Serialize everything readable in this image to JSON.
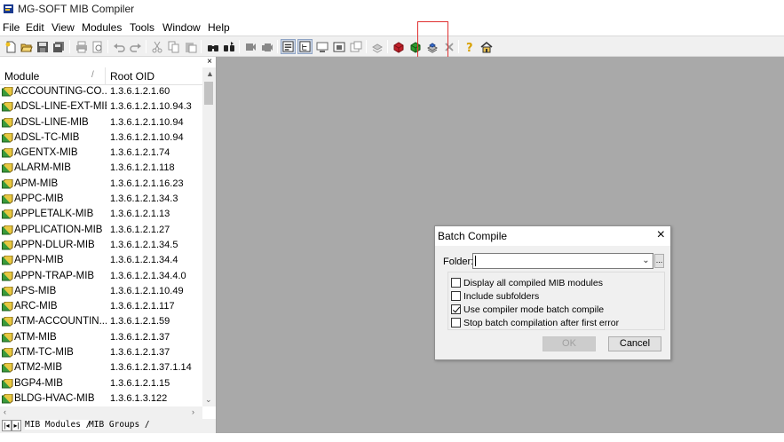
{
  "window": {
    "title": "MG-SOFT MIB Compiler"
  },
  "menu": [
    "File",
    "Edit",
    "View",
    "Modules",
    "Tools",
    "Window",
    "Help"
  ],
  "left_pane": {
    "close_glyph": "×",
    "columns": {
      "module": "Module",
      "root_oid": "Root OID",
      "sort_indicator": "/"
    },
    "rows": [
      {
        "module": "ACCOUNTING-CO...",
        "oid": "1.3.6.1.2.1.60"
      },
      {
        "module": "ADSL-LINE-EXT-MIB",
        "oid": "1.3.6.1.2.1.10.94.3"
      },
      {
        "module": "ADSL-LINE-MIB",
        "oid": "1.3.6.1.2.1.10.94"
      },
      {
        "module": "ADSL-TC-MIB",
        "oid": "1.3.6.1.2.1.10.94"
      },
      {
        "module": "AGENTX-MIB",
        "oid": "1.3.6.1.2.1.74"
      },
      {
        "module": "ALARM-MIB",
        "oid": "1.3.6.1.2.1.118"
      },
      {
        "module": "APM-MIB",
        "oid": "1.3.6.1.2.1.16.23"
      },
      {
        "module": "APPC-MIB",
        "oid": "1.3.6.1.2.1.34.3"
      },
      {
        "module": "APPLETALK-MIB",
        "oid": "1.3.6.1.2.1.13"
      },
      {
        "module": "APPLICATION-MIB",
        "oid": "1.3.6.1.2.1.27"
      },
      {
        "module": "APPN-DLUR-MIB",
        "oid": "1.3.6.1.2.1.34.5"
      },
      {
        "module": "APPN-MIB",
        "oid": "1.3.6.1.2.1.34.4"
      },
      {
        "module": "APPN-TRAP-MIB",
        "oid": "1.3.6.1.2.1.34.4.0"
      },
      {
        "module": "APS-MIB",
        "oid": "1.3.6.1.2.1.10.49"
      },
      {
        "module": "ARC-MIB",
        "oid": "1.3.6.1.2.1.117"
      },
      {
        "module": "ATM-ACCOUNTIN...",
        "oid": "1.3.6.1.2.1.59"
      },
      {
        "module": "ATM-MIB",
        "oid": "1.3.6.1.2.1.37"
      },
      {
        "module": "ATM-TC-MIB",
        "oid": "1.3.6.1.2.1.37"
      },
      {
        "module": "ATM2-MIB",
        "oid": "1.3.6.1.2.1.37.1.14"
      },
      {
        "module": "BGP4-MIB",
        "oid": "1.3.6.1.2.1.15"
      },
      {
        "module": "BLDG-HVAC-MIB",
        "oid": "1.3.6.1.3.122"
      }
    ],
    "tabs": [
      "MIB Modules",
      "MIB Groups"
    ]
  },
  "dialog": {
    "title": "Batch Compile",
    "folder_label": "Folder:",
    "folder_value": "",
    "browse_label": "...",
    "options": [
      {
        "label": "Display all compiled MIB modules",
        "checked": false
      },
      {
        "label": "Include subfolders",
        "checked": false
      },
      {
        "label": "Use compiler mode batch compile",
        "checked": true
      },
      {
        "label": "Stop batch compilation after first error",
        "checked": false
      }
    ],
    "ok_label": "OK",
    "cancel_label": "Cancel"
  },
  "toolbar_icons": [
    "new-icon",
    "open-icon",
    "save-icon",
    "save-all-icon",
    "print-icon",
    "print-preview-icon",
    "undo-icon",
    "redo-icon",
    "cut-icon",
    "copy-icon",
    "paste-icon",
    "find-icon",
    "find-next-icon",
    "compile-icon",
    "compile-all-icon",
    "module-list-icon",
    "tree-view-icon",
    "scan-icon",
    "export-icon",
    "properties-icon",
    "batch-compile-icon",
    "remove-icon",
    "unload-icon",
    "help-icon",
    "home-icon"
  ],
  "colors": {
    "workspace": "#a9a9a9",
    "highlight": "#e03030"
  }
}
